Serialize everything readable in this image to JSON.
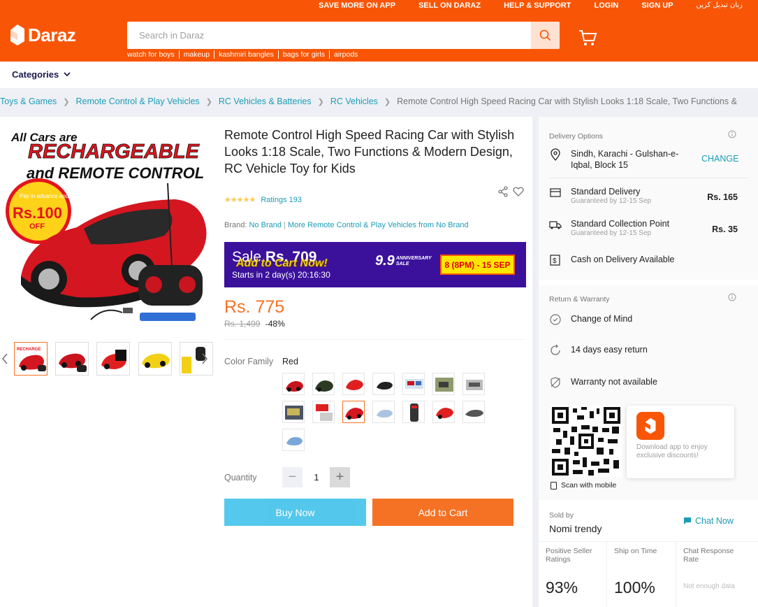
{
  "header": {
    "top_links": [
      "SAVE MORE ON APP",
      "SELL ON DARAZ",
      "HELP & SUPPORT",
      "LOGIN",
      "SIGN UP"
    ],
    "language_switch": "زبان تبدیل کریں",
    "logo_text": "Daraz",
    "search_placeholder": "Search in Daraz",
    "suggestions": [
      "watch for boys",
      "makeup",
      "kashmiri bangles",
      "bags for girls",
      "airpods"
    ],
    "brand_color": "#f85606"
  },
  "categories_label": "Categories",
  "breadcrumbs": [
    "Toys & Games",
    "Remote Control & Play Vehicles",
    "RC Vehicles & Batteries",
    "RC Vehicles",
    "Remote Control High Speed Racing Car with Stylish Looks 1:18 Scale, Two Functions &"
  ],
  "product": {
    "image_headline_1": "All Cars are",
    "image_headline_2": "RECHARGEABLE",
    "image_headline_3": "and REMOTE CONTROL",
    "image_badge_top": "Pay in advance and Get",
    "image_badge_amount": "Rs.100",
    "image_badge_off": "OFF",
    "title": "Remote Control High Speed Racing Car with Stylish Looks 1:18 Scale, Two Functions & Modern Design, RC Vehicle Toy for Kids",
    "ratings_label": "Ratings 193",
    "stars": 4.5,
    "brand_label": "Brand:",
    "brand_name": "No Brand",
    "more_from": "More Remote Control & Play Vehicles from No Brand",
    "banner": {
      "sale_prefix": "Sale",
      "sale_price": "Rs. 709",
      "cta": "Add to Cart Now!",
      "starts": "Starts in 2 day(s) 20:16:30",
      "event": "9.9",
      "event_sub": "ANNIVERSARY SALE",
      "date": "8 (8PM) - 15 SEP"
    },
    "price": "Rs. 775",
    "original_price": "Rs. 1,499",
    "discount": "-48%",
    "color_family_label": "Color Family",
    "color_family_value": "Red",
    "quantity_label": "Quantity",
    "quantity_value": "1",
    "buy_now": "Buy Now",
    "add_to_cart": "Add to Cart",
    "accent": "#f57224"
  },
  "delivery": {
    "title": "Delivery Options",
    "location": "Sindh, Karachi - Gulshan-e-Iqbal, Block 15",
    "change": "CHANGE",
    "options": [
      {
        "name": "Standard Delivery",
        "sub": "Guaranteed by 12-15 Sep",
        "fee": "Rs. 165"
      },
      {
        "name": "Standard Collection Point",
        "sub": "Guaranteed by 12-15 Sep",
        "fee": "Rs. 35"
      }
    ],
    "cod": "Cash on Delivery Available"
  },
  "warranty": {
    "title": "Return & Warranty",
    "items": [
      "Change of Mind",
      "14 days easy return",
      "Warranty not available"
    ]
  },
  "app_promo": {
    "scan_text": "Scan with mobile",
    "download_text": "Download app to enjoy exclusive discounts!"
  },
  "seller": {
    "sold_by": "Sold by",
    "name": "Nomi trendy",
    "chat": "Chat Now",
    "stats": [
      {
        "label": "Positive Seller Ratings",
        "value": "93%"
      },
      {
        "label": "Ship on Time",
        "value": "100%"
      },
      {
        "label": "Chat Response Rate",
        "value": "Not enough data"
      }
    ]
  }
}
